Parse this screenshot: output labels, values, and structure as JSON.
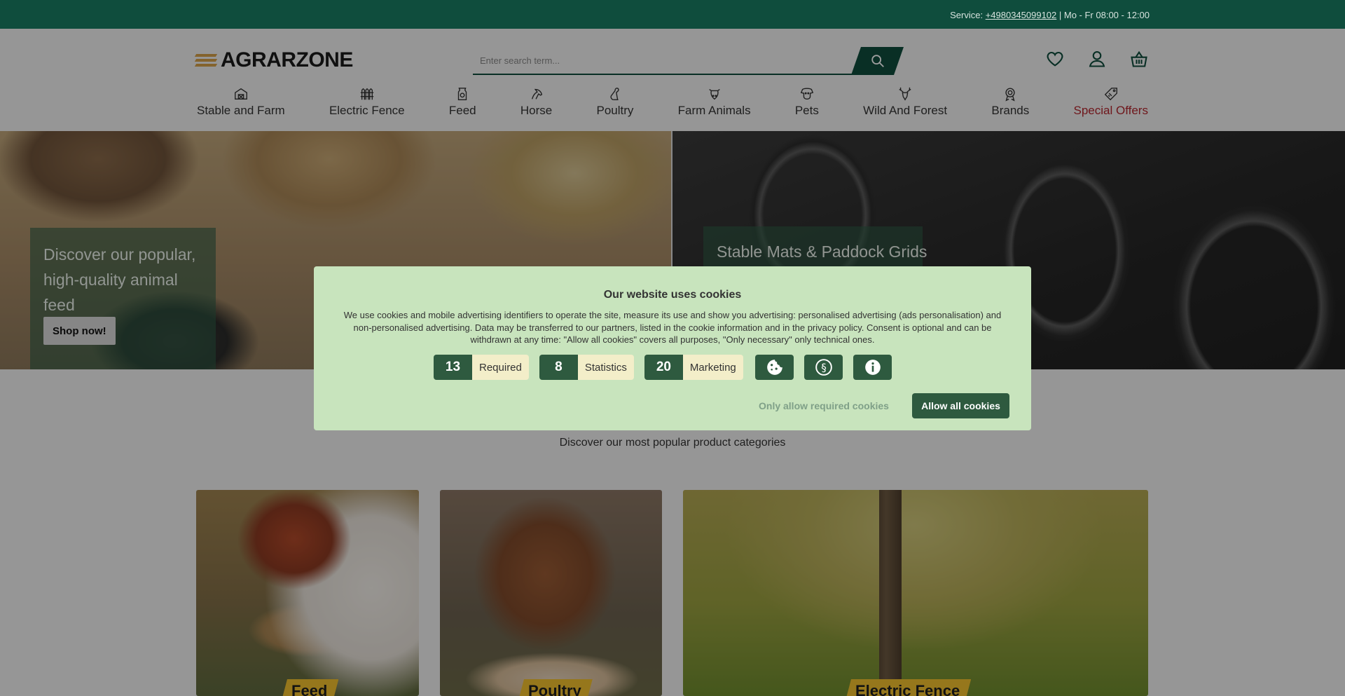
{
  "topbar": {
    "service_label": "Service: ",
    "phone": "+4980345099102",
    "hours": " | Mo - Fr 08:00 - 12:00"
  },
  "header": {
    "logo_text": "AGRARZONE",
    "search_placeholder": "Enter search term...",
    "icons": [
      "heart-icon",
      "user-icon",
      "basket-icon"
    ]
  },
  "nav": {
    "items": [
      {
        "label": "Stable and Farm",
        "icon": "barn-icon"
      },
      {
        "label": "Electric Fence",
        "icon": "fence-icon"
      },
      {
        "label": "Feed",
        "icon": "feed-bag-icon"
      },
      {
        "label": "Horse",
        "icon": "horse-icon"
      },
      {
        "label": "Poultry",
        "icon": "chicken-icon"
      },
      {
        "label": "Farm Animals",
        "icon": "cow-icon"
      },
      {
        "label": "Pets",
        "icon": "dog-icon"
      },
      {
        "label": "Wild And Forest",
        "icon": "deer-icon"
      },
      {
        "label": "Brands",
        "icon": "rosette-icon"
      },
      {
        "label": "Special Offers",
        "icon": "tag-icon"
      }
    ]
  },
  "hero": {
    "left_title": "Discover our popular, high-quality animal feed",
    "left_button": "Shop now!",
    "right_title": "Stable Mats & Paddock Grids"
  },
  "categories": {
    "subtitle": "Discover our most popular product categories",
    "cards": [
      {
        "label": "Feed"
      },
      {
        "label": "Poultry"
      },
      {
        "label": "Electric Fence"
      }
    ]
  },
  "cookie": {
    "title": "Our website uses cookies",
    "text": "We use cookies and mobile advertising identifiers to operate the site, measure its use and show you advertising: personalised advertising (ads personalisation) and non-personalised advertising. Data may be transferred to our partners, listed in the cookie information and in the privacy policy. Consent is optional and can be withdrawn at any time: \"Allow all cookies\" covers all purposes, \"Only necessary\" only technical ones.",
    "chips": [
      {
        "count": "13",
        "label": "Required"
      },
      {
        "count": "8",
        "label": "Statistics"
      },
      {
        "count": "20",
        "label": "Marketing"
      }
    ],
    "icon_buttons": [
      "cookie-icon",
      "paragraph-icon",
      "info-icon"
    ],
    "only_required": "Only allow required cookies",
    "allow_all": "Allow all cookies"
  },
  "colors": {
    "brand_green": "#0f4d3d",
    "cookie_bg": "#c8e4bd",
    "cookie_button": "#2e5a3f",
    "special_red": "#b3262e",
    "tag_yellow": "#f2c12e"
  }
}
